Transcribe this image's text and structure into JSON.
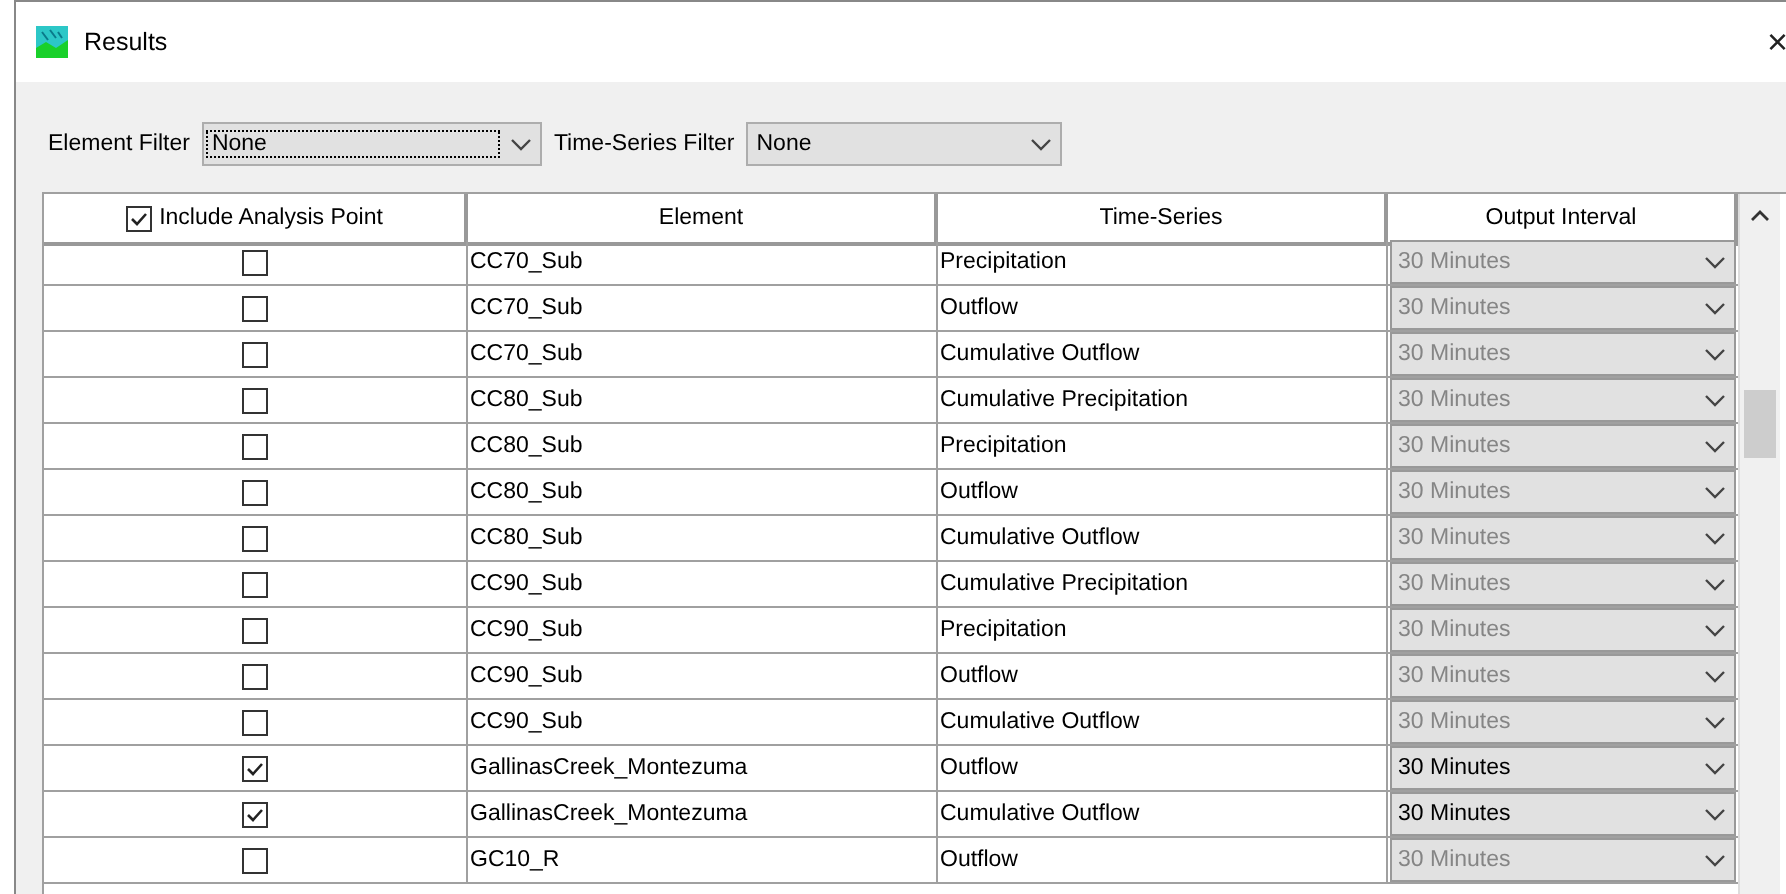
{
  "window": {
    "title": "Results",
    "close": "×"
  },
  "filters": [
    {
      "label": "Element Filter",
      "value": "None",
      "focused": true
    },
    {
      "label": "Time-Series Filter",
      "value": "None",
      "focused": false
    }
  ],
  "table": {
    "columns": [
      "Include Analysis Point",
      "Element",
      "Time-Series",
      "Output Interval"
    ],
    "header_checked": true,
    "rows": [
      {
        "checked": false,
        "element": "CC70_Sub",
        "time_series": "Precipitation",
        "interval": "30 Minutes"
      },
      {
        "checked": false,
        "element": "CC70_Sub",
        "time_series": "Outflow",
        "interval": "30 Minutes"
      },
      {
        "checked": false,
        "element": "CC70_Sub",
        "time_series": "Cumulative Outflow",
        "interval": "30 Minutes"
      },
      {
        "checked": false,
        "element": "CC80_Sub",
        "time_series": "Cumulative Precipitation",
        "interval": "30 Minutes"
      },
      {
        "checked": false,
        "element": "CC80_Sub",
        "time_series": "Precipitation",
        "interval": "30 Minutes"
      },
      {
        "checked": false,
        "element": "CC80_Sub",
        "time_series": "Outflow",
        "interval": "30 Minutes"
      },
      {
        "checked": false,
        "element": "CC80_Sub",
        "time_series": "Cumulative Outflow",
        "interval": "30 Minutes"
      },
      {
        "checked": false,
        "element": "CC90_Sub",
        "time_series": "Cumulative Precipitation",
        "interval": "30 Minutes"
      },
      {
        "checked": false,
        "element": "CC90_Sub",
        "time_series": "Precipitation",
        "interval": "30 Minutes"
      },
      {
        "checked": false,
        "element": "CC90_Sub",
        "time_series": "Outflow",
        "interval": "30 Minutes"
      },
      {
        "checked": false,
        "element": "CC90_Sub",
        "time_series": "Cumulative Outflow",
        "interval": "30 Minutes"
      },
      {
        "checked": true,
        "element": "GallinasCreek_Montezuma",
        "time_series": "Outflow",
        "interval": "30 Minutes"
      },
      {
        "checked": true,
        "element": "GallinasCreek_Montezuma",
        "time_series": "Cumulative Outflow",
        "interval": "30 Minutes"
      },
      {
        "checked": false,
        "element": "GC10_R",
        "time_series": "Outflow",
        "interval": "30 Minutes"
      }
    ]
  }
}
